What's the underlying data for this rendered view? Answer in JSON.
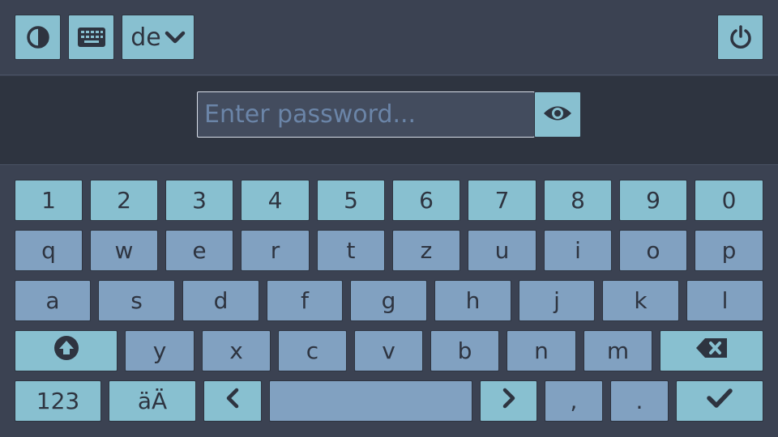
{
  "topbar": {
    "contrast_icon": "contrast-icon",
    "keyboard_icon": "keyboard-icon",
    "language": {
      "label": "de",
      "icon": "chevron-down-icon"
    },
    "power_icon": "power-icon"
  },
  "password": {
    "placeholder": "Enter password...",
    "value": "",
    "reveal_icon": "eye-icon"
  },
  "keyboard": {
    "row1": [
      "1",
      "2",
      "3",
      "4",
      "5",
      "6",
      "7",
      "8",
      "9",
      "0"
    ],
    "row2": [
      "q",
      "w",
      "e",
      "r",
      "t",
      "z",
      "u",
      "i",
      "o",
      "p"
    ],
    "row3": [
      "a",
      "s",
      "d",
      "f",
      "g",
      "h",
      "j",
      "k",
      "l"
    ],
    "row4": [
      "y",
      "x",
      "c",
      "v",
      "b",
      "n",
      "m"
    ],
    "shift_icon": "shift-icon",
    "backspace_icon": "backspace-icon",
    "numbers_label": "123",
    "umlaut_label": "äÄ",
    "left_icon": "chevron-left-icon",
    "space_label": "",
    "right_icon": "chevron-right-icon",
    "comma_label": ",",
    "period_label": ".",
    "enter_icon": "checkmark-icon"
  },
  "colors": {
    "background": "#3b4252",
    "band": "#2e3440",
    "accent_key": "#88c0d0",
    "letter_key": "#81a1c1",
    "text": "#2e3440"
  }
}
